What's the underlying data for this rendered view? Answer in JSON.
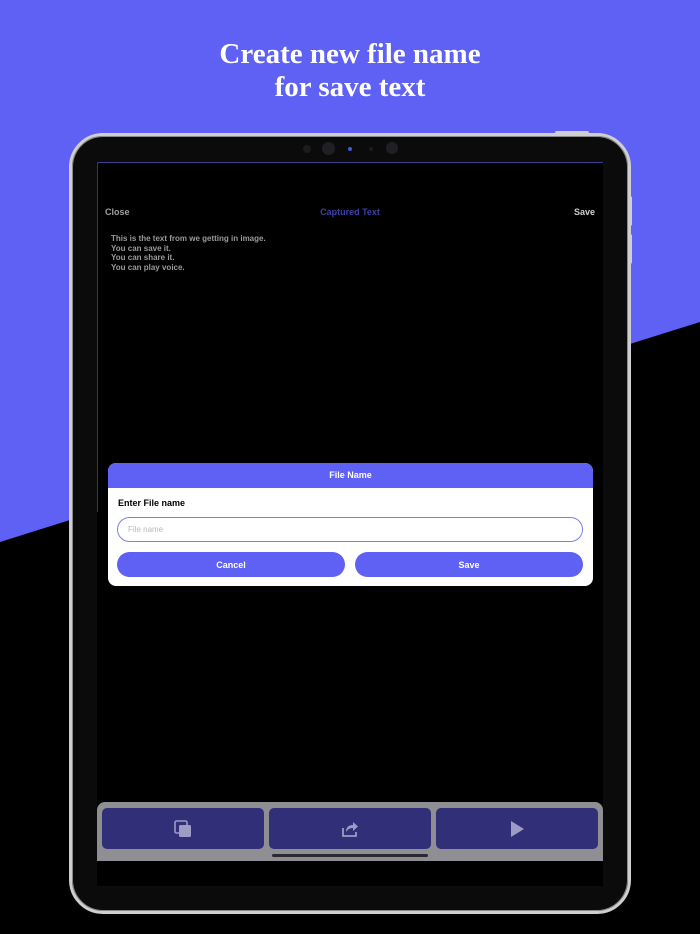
{
  "headline": {
    "line1": "Create new file name",
    "line2": "for save text"
  },
  "colors": {
    "brand": "#5f60f4",
    "toolbar_button": "#302f78"
  },
  "nav": {
    "close_label": "Close",
    "title": "Captured Text",
    "save_label": "Save"
  },
  "content": {
    "lines": [
      "This is the text from we getting in image.",
      "You can save it.",
      "You can share it.",
      "You can play voice."
    ]
  },
  "dialog": {
    "title": "File Name",
    "label": "Enter File name",
    "input_value": "",
    "input_placeholder": "File name",
    "cancel_label": "Cancel",
    "save_label": "Save"
  },
  "toolbar": {
    "icons": [
      "copy-icon",
      "share-icon",
      "play-icon"
    ]
  }
}
